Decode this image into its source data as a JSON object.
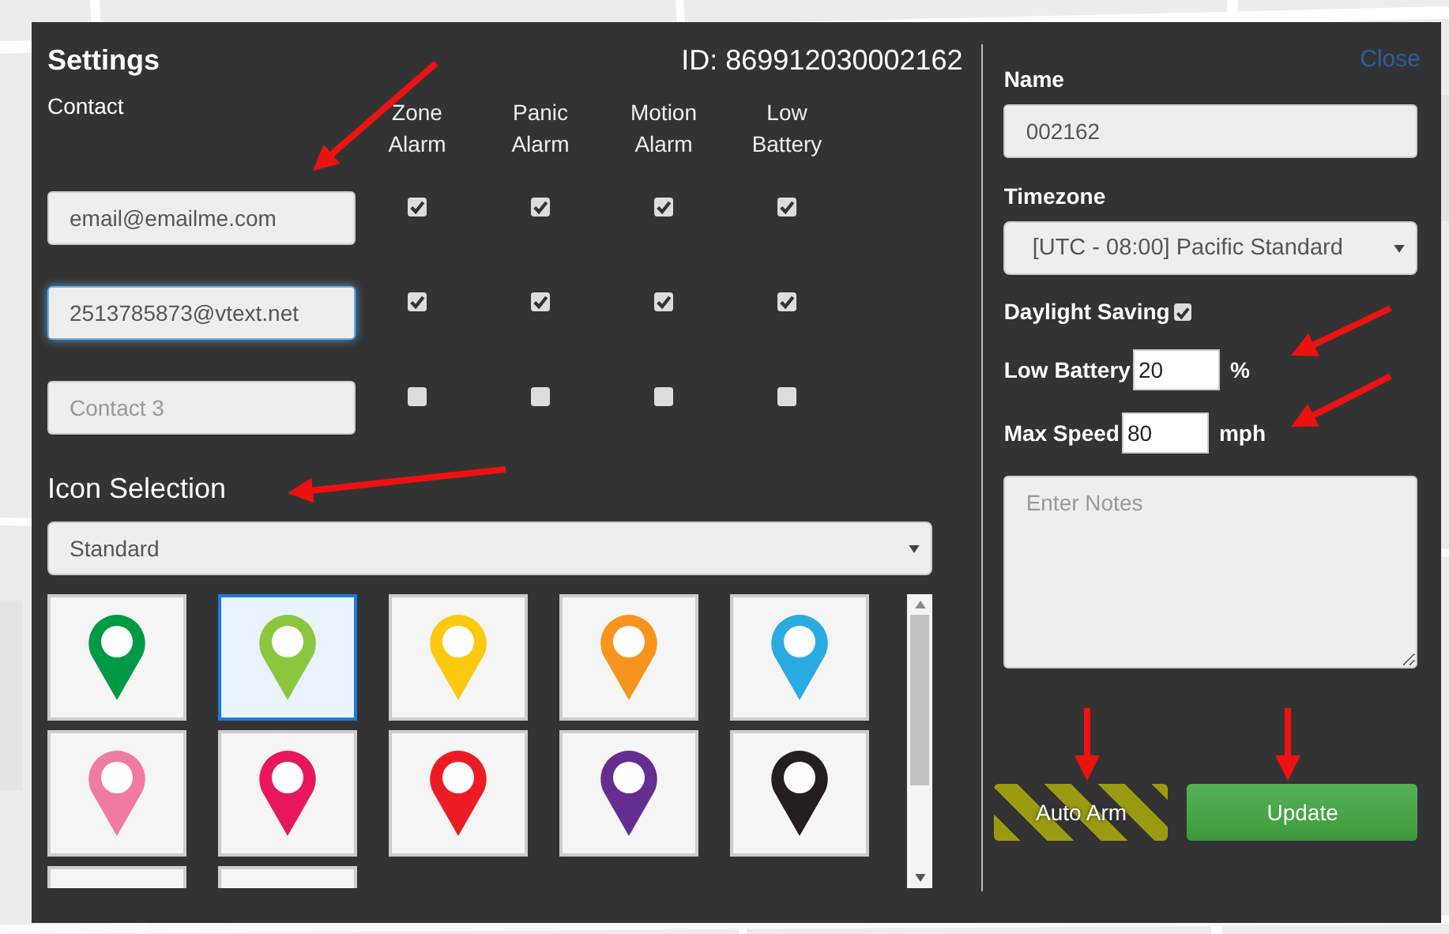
{
  "dialog": {
    "title": "Settings",
    "device_id": "ID: 869912030002162",
    "close": "Close"
  },
  "contacts": {
    "label": "Contact",
    "columns": [
      "Zone Alarm",
      "Panic Alarm",
      "Motion Alarm",
      "Low Battery"
    ],
    "rows": [
      {
        "value": "email@emailme.com",
        "focused": false,
        "alerts": [
          {
            "checked": true
          },
          {
            "checked": true
          },
          {
            "checked": true
          },
          {
            "checked": true
          }
        ]
      },
      {
        "value": "2513785873@vtext.net",
        "focused": true,
        "alerts": [
          {
            "checked": true
          },
          {
            "checked": true
          },
          {
            "checked": true
          },
          {
            "checked": true
          }
        ]
      },
      {
        "placeholder": "Contact 3",
        "focused": false,
        "alerts": [
          {
            "checked": false
          },
          {
            "checked": false
          },
          {
            "checked": false
          },
          {
            "checked": false
          }
        ]
      }
    ]
  },
  "icon_selection": {
    "title": "Icon Selection",
    "set": "Standard",
    "icons": [
      {
        "color": "#009a44",
        "selected": false
      },
      {
        "color": "#8cc63f",
        "selected": true
      },
      {
        "color": "#fdc90f",
        "selected": false
      },
      {
        "color": "#f7941d",
        "selected": false
      },
      {
        "color": "#29abe2",
        "selected": false
      },
      {
        "color": "#f07aa0",
        "selected": false
      },
      {
        "color": "#e8175d",
        "selected": false
      },
      {
        "color": "#ed1c24",
        "selected": false
      },
      {
        "color": "#662d91",
        "selected": false
      },
      {
        "color": "#231f20",
        "selected": false
      },
      {
        "selected": false
      },
      {
        "selected": false
      }
    ]
  },
  "name": {
    "label": "Name",
    "value": "002162"
  },
  "timezone": {
    "label": "Timezone",
    "value": "[UTC - 08:00] Pacific Standard"
  },
  "daylight_saving": {
    "label": "Daylight Saving",
    "checked": true
  },
  "low_battery": {
    "label": "Low Battery",
    "value": "20",
    "unit": "%"
  },
  "max_speed": {
    "label": "Max Speed",
    "value": "80",
    "unit": "mph"
  },
  "notes": {
    "placeholder": "Enter Notes"
  },
  "buttons": [
    {
      "label": "Auto Arm",
      "kind": "striped"
    },
    {
      "label": "Update",
      "kind": "primary"
    }
  ]
}
